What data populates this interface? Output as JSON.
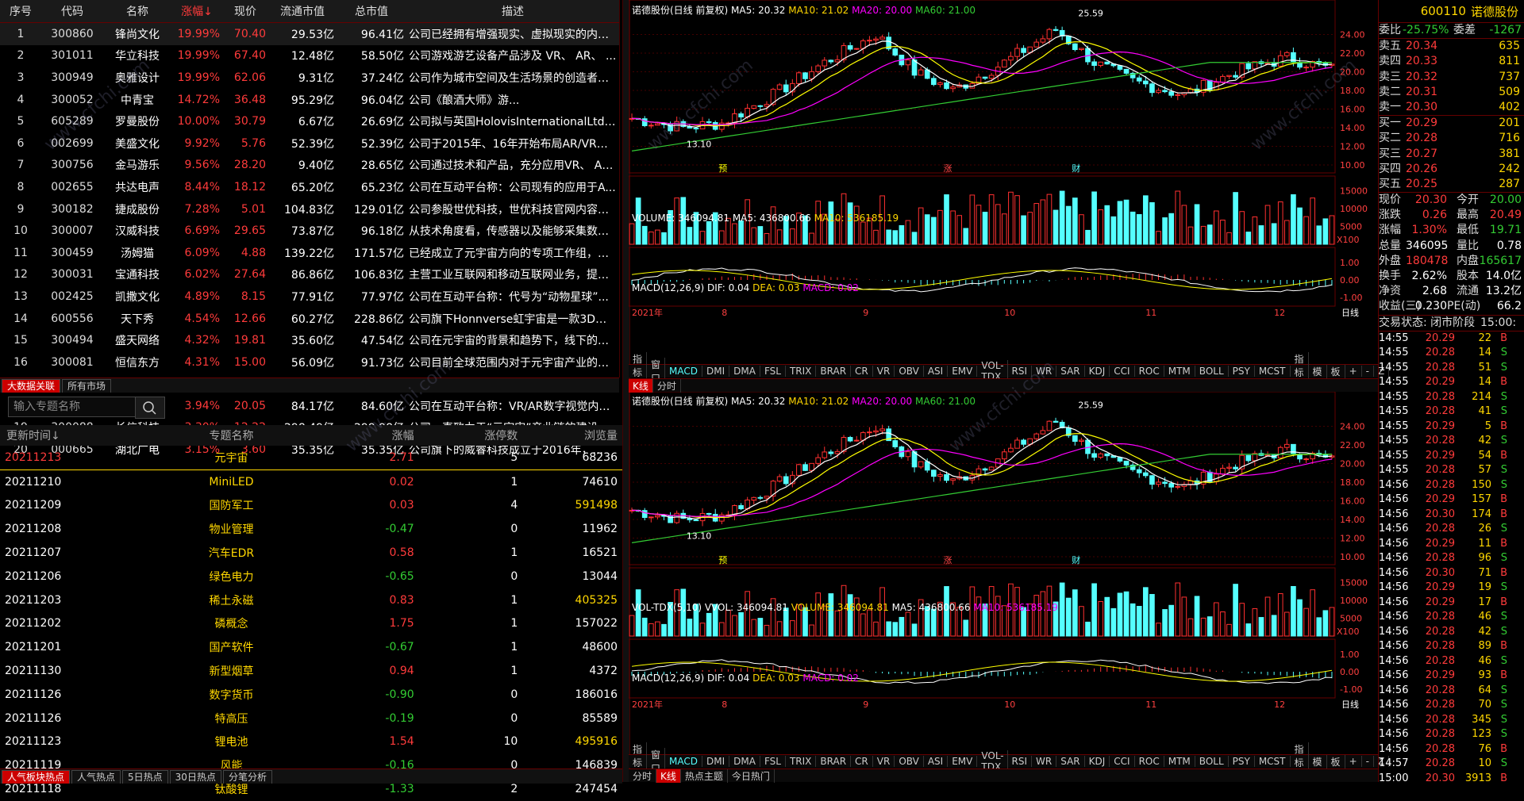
{
  "stock_table": {
    "headers": [
      "序号",
      "代码",
      "名称",
      "涨幅↓",
      "现价",
      "流通市值",
      "总市值",
      "描述"
    ],
    "rows": [
      [
        "1",
        "300860",
        "锋尚文化",
        "19.99%",
        "70.40",
        "29.53亿",
        "96.41亿",
        "公司已经拥有增强现实、虚拟现实的内容..."
      ],
      [
        "2",
        "301011",
        "华立科技",
        "19.99%",
        "67.40",
        "12.48亿",
        "58.50亿",
        "公司游戏游艺设备产品涉及 VR、 AR、 ..."
      ],
      [
        "3",
        "300949",
        "奥雅设计",
        "19.99%",
        "62.06",
        "9.31亿",
        "37.24亿",
        "公司作为城市空间及生活场景的创造者，..."
      ],
      [
        "4",
        "300052",
        "中青宝",
        "14.72%",
        "36.48",
        "95.29亿",
        "96.04亿",
        "公司《酿酒大师》游..."
      ],
      [
        "5",
        "605289",
        "罗曼股份",
        "10.00%",
        "30.79",
        "6.67亿",
        "26.69亿",
        "公司拟与英国HolovisInternationalLtd...."
      ],
      [
        "6",
        "002699",
        "美盛文化",
        "9.92%",
        "5.76",
        "52.39亿",
        "52.39亿",
        "公司于2015年、16年开始布局AR/VR产..."
      ],
      [
        "7",
        "300756",
        "金马游乐",
        "9.56%",
        "28.20",
        "9.40亿",
        "28.65亿",
        "公司通过技术和产品，充分应用VR、 AR..."
      ],
      [
        "8",
        "002655",
        "共达电声",
        "8.44%",
        "18.12",
        "65.20亿",
        "65.23亿",
        "公司在互动平台称：公司现有的应用于A..."
      ],
      [
        "9",
        "300182",
        "捷成股份",
        "7.28%",
        "5.01",
        "104.83亿",
        "129.01亿",
        "公司参股世优科技，世优科技官网内容显..."
      ],
      [
        "10",
        "300007",
        "汉威科技",
        "6.69%",
        "29.65",
        "73.87亿",
        "96.18亿",
        "从技术角度看，传感器以及能够采集数据..."
      ],
      [
        "11",
        "300459",
        "汤姆猫",
        "6.09%",
        "4.88",
        "139.22亿",
        "171.57亿",
        "已经成立了元宇宙方向的专项工作组，协..."
      ],
      [
        "12",
        "300031",
        "宝通科技",
        "6.02%",
        "27.64",
        "86.86亿",
        "106.83亿",
        "主营工业互联网和移动互联网业务，提供..."
      ],
      [
        "13",
        "002425",
        "凯撒文化",
        "4.89%",
        "8.15",
        "77.91亿",
        "77.97亿",
        "公司在互动平台称：代号为“动物星球”..."
      ],
      [
        "14",
        "600556",
        "天下秀",
        "4.54%",
        "12.66",
        "60.27亿",
        "228.86亿",
        "公司旗下Honnverse虹宇宙是一款3D版..."
      ],
      [
        "15",
        "300494",
        "盛天网络",
        "4.32%",
        "19.81",
        "35.60亿",
        "47.54亿",
        "公司在元宇宙的背景和趋势下，线下的网..."
      ],
      [
        "16",
        "300081",
        "恒信东方",
        "4.31%",
        "15.00",
        "56.09亿",
        "91.73亿",
        "公司目前全球范围内对于元宇宙产业的发..."
      ],
      [
        "17",
        "300556",
        "丝路视觉",
        "4.25%",
        "28.21",
        "25.45亿",
        "33.64亿",
        "公司持续推动VR/AR领域内容和应用的开..."
      ],
      [
        "18",
        "603466",
        "风语筑",
        "3.94%",
        "20.05",
        "84.17亿",
        "84.60亿",
        "公司在互动平台称：VR/AR数字视觉内容..."
      ],
      [
        "19",
        "300088",
        "长信科技",
        "3.30%",
        "12.22",
        "298.49亿",
        "299.98亿",
        "公司一直致力于“元宇宙”产业链的建设..."
      ],
      [
        "20",
        "000665",
        "湖北广电",
        "3.15%",
        "3.60",
        "35.35亿",
        "35.35亿",
        "公司旗下的威睿科技成立于2016年，..."
      ]
    ],
    "tabs": [
      "大数据关联",
      "所有市场"
    ]
  },
  "topic": {
    "search_placeholder": "输入专题名称",
    "headers": [
      "更新时间↓",
      "专题名称",
      "涨幅",
      "涨停数",
      "浏览量"
    ],
    "rows": [
      [
        "20211213",
        "元宇宙",
        "2.71",
        "5",
        "68236"
      ],
      [
        "20211210",
        "MiniLED",
        "0.02",
        "1",
        "74610"
      ],
      [
        "20211209",
        "国防军工",
        "0.03",
        "4",
        "591498"
      ],
      [
        "20211208",
        "物业管理",
        "-0.47",
        "0",
        "11962"
      ],
      [
        "20211207",
        "汽车EDR",
        "0.58",
        "1",
        "16521"
      ],
      [
        "20211206",
        "绿色电力",
        "-0.65",
        "0",
        "13044"
      ],
      [
        "20211203",
        "稀土永磁",
        "0.83",
        "1",
        "405325"
      ],
      [
        "20211202",
        "磷概念",
        "1.75",
        "1",
        "157022"
      ],
      [
        "20211201",
        "国产软件",
        "-0.67",
        "1",
        "48600"
      ],
      [
        "20211130",
        "新型烟草",
        "0.94",
        "1",
        "4372"
      ],
      [
        "20211126",
        "数字货币",
        "-0.90",
        "0",
        "186016"
      ],
      [
        "20211126",
        "特高压",
        "-0.19",
        "0",
        "85589"
      ],
      [
        "20211123",
        "锂电池",
        "1.54",
        "10",
        "495916"
      ],
      [
        "20211119",
        "风能",
        "-0.16",
        "0",
        "146839"
      ],
      [
        "20211118",
        "钛酸锂",
        "-1.33",
        "2",
        "247454"
      ]
    ],
    "tabs": [
      "人气板块热点",
      "人气热点",
      "5日热点",
      "30日热点",
      "分笔分析"
    ]
  },
  "chart_top": {
    "title": "诺德股份(日线 前复权)",
    "ma5": "MA5: 20.32",
    "ma10": "MA10: 21.02",
    "ma20": "MA20: 20.00",
    "ma60": "MA60: 21.00",
    "high_label": "25.59",
    "low_label": "13.10",
    "y_ticks": [
      "24.00",
      "22.00",
      "20.00",
      "18.00",
      "16.00",
      "14.00",
      "12.00",
      "10.00"
    ],
    "events": [
      "预",
      "涨",
      "财"
    ],
    "vol_label": "VOLUME: 346094.81",
    "vol_ma5": "MA5: 436800.66",
    "vol_ma10": "MA10: 536185.19",
    "vol_ticks": [
      "15000",
      "10000",
      "5000",
      "X100"
    ],
    "macd_label": "MACD(12,26,9)",
    "dif": "DIF: 0.04",
    "dea": "DEA: 0.03",
    "macd": "MACD: 0.02",
    "macd_ticks": [
      "1.00",
      "0.00",
      "-1.00"
    ],
    "x_labels": [
      "2021年",
      "8",
      "9",
      "10",
      "11",
      "12"
    ],
    "right_label": "日线"
  },
  "chart_bottom": {
    "vol_label": "VOL-TDX(5,10) VVOL: 346094.81",
    "vol_ma5": "VOLUME: 346094.81",
    "vol_ma5b": "MA5: 436800.66",
    "vol_ma10": "MA10: 536185.19"
  },
  "toolbar": [
    "指标A",
    "窗口",
    "MACD",
    "DMI",
    "DMA",
    "FSL",
    "TRIX",
    "BRAR",
    "CR",
    "VR",
    "OBV",
    "ASI",
    "EMV",
    "VOL-TDX",
    "RSI",
    "WR",
    "SAR",
    "KDJ",
    "CCI",
    "ROC",
    "MTM",
    "BOLL",
    "PSY",
    "MCST",
    "指标B",
    "模",
    "板",
    "+",
    "-",
    "Z"
  ],
  "mid_tabs": [
    "K线",
    "分时"
  ],
  "bottom_tabs": [
    "分时",
    "K线",
    "热点主题",
    "今日热门"
  ],
  "quote": {
    "code": "600110",
    "name": "诺德股份",
    "weibi_label": "委比",
    "weibi": "-25.75%",
    "weicha_label": "委差",
    "weicha": "-1267",
    "asks": [
      [
        "卖五",
        "20.34",
        "635"
      ],
      [
        "卖四",
        "20.33",
        "811"
      ],
      [
        "卖三",
        "20.32",
        "737"
      ],
      [
        "卖二",
        "20.31",
        "509"
      ],
      [
        "卖一",
        "20.30",
        "402"
      ]
    ],
    "bids": [
      [
        "买一",
        "20.29",
        "201"
      ],
      [
        "买二",
        "20.28",
        "716"
      ],
      [
        "买三",
        "20.27",
        "381"
      ],
      [
        "买四",
        "20.26",
        "242"
      ],
      [
        "买五",
        "20.25",
        "287"
      ]
    ],
    "stats": [
      [
        "现价",
        "20.30",
        "今开",
        "20.00"
      ],
      [
        "涨跌",
        "0.26",
        "最高",
        "20.49"
      ],
      [
        "涨幅",
        "1.30%",
        "最低",
        "19.71"
      ],
      [
        "总量",
        "346095",
        "量比",
        "0.78"
      ],
      [
        "外盘",
        "180478",
        "内盘",
        "165617"
      ],
      [
        "换手",
        "2.62%",
        "股本",
        "14.0亿"
      ],
      [
        "净资",
        "2.68",
        "流通",
        "13.2亿"
      ],
      [
        "收益(三)",
        "0.230",
        "PE(动)",
        "66.2"
      ]
    ],
    "status_label": "交易状态: 闭市阶段",
    "status_time": "15:00:",
    "ticks": [
      [
        "14:55",
        "20.29",
        "22",
        "B"
      ],
      [
        "14:55",
        "20.28",
        "14",
        "S"
      ],
      [
        "14:55",
        "20.28",
        "51",
        "S"
      ],
      [
        "14:55",
        "20.29",
        "14",
        "B"
      ],
      [
        "14:55",
        "20.28",
        "214",
        "S"
      ],
      [
        "14:55",
        "20.28",
        "41",
        "S"
      ],
      [
        "14:55",
        "20.29",
        "5",
        "B"
      ],
      [
        "14:55",
        "20.28",
        "42",
        "S"
      ],
      [
        "14:55",
        "20.29",
        "54",
        "B"
      ],
      [
        "14:55",
        "20.28",
        "57",
        "S"
      ],
      [
        "14:56",
        "20.28",
        "150",
        "S"
      ],
      [
        "14:56",
        "20.29",
        "157",
        "B"
      ],
      [
        "14:56",
        "20.30",
        "174",
        "B"
      ],
      [
        "14:56",
        "20.28",
        "26",
        "S"
      ],
      [
        "14:56",
        "20.29",
        "11",
        "B"
      ],
      [
        "14:56",
        "20.28",
        "96",
        "S"
      ],
      [
        "14:56",
        "20.30",
        "71",
        "B"
      ],
      [
        "14:56",
        "20.29",
        "19",
        "S"
      ],
      [
        "14:56",
        "20.29",
        "17",
        "B"
      ],
      [
        "14:56",
        "20.28",
        "46",
        "S"
      ],
      [
        "14:56",
        "20.28",
        "42",
        "S"
      ],
      [
        "14:56",
        "20.28",
        "89",
        "B"
      ],
      [
        "14:56",
        "20.28",
        "46",
        "S"
      ],
      [
        "14:56",
        "20.29",
        "93",
        "B"
      ],
      [
        "14:56",
        "20.28",
        "64",
        "S"
      ],
      [
        "14:56",
        "20.28",
        "70",
        "S"
      ],
      [
        "14:56",
        "20.28",
        "345",
        "S"
      ],
      [
        "14:56",
        "20.28",
        "123",
        "S"
      ],
      [
        "14:56",
        "20.28",
        "76",
        "B"
      ],
      [
        "14:57",
        "20.28",
        "10",
        "S"
      ],
      [
        "15:00",
        "20.30",
        "3913",
        "B"
      ]
    ]
  },
  "watermark": "www.cfchi.com"
}
